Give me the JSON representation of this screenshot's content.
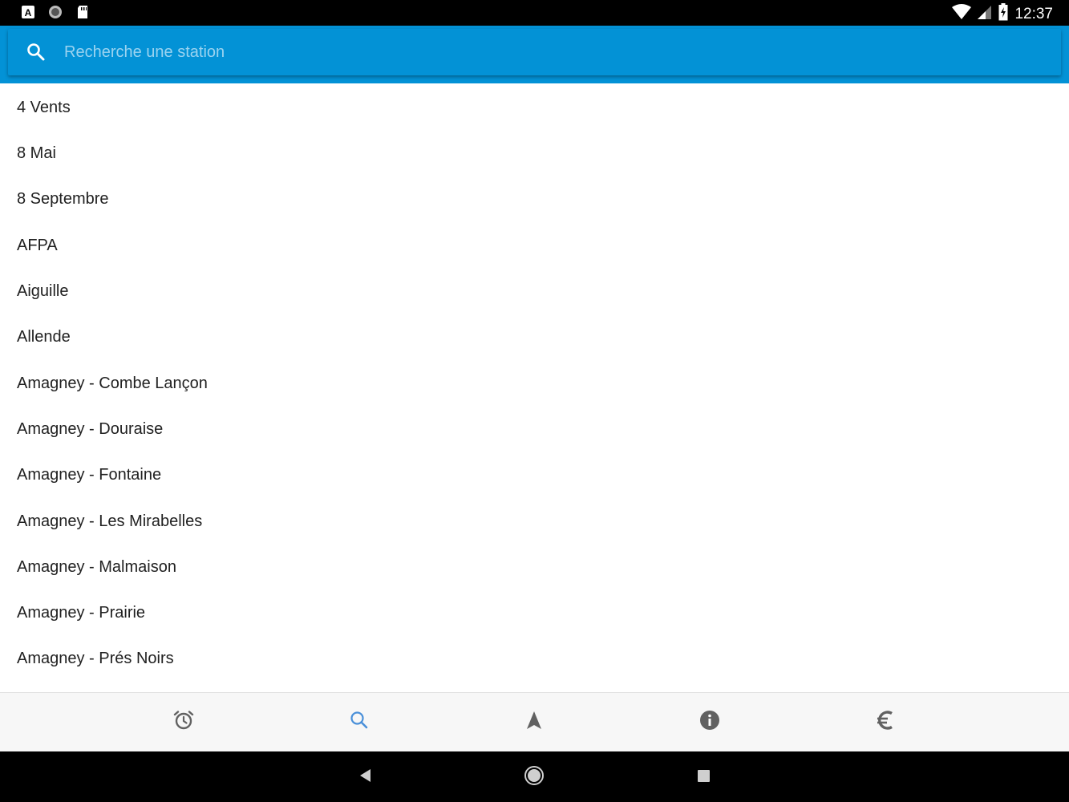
{
  "status_bar": {
    "time": "12:37",
    "left_icons": [
      "a-box-icon",
      "circle-icon",
      "sd-card-icon"
    ],
    "right_icons": [
      "wifi-icon",
      "signal-icon",
      "battery-charging-icon"
    ]
  },
  "search": {
    "placeholder": "Recherche une station",
    "value": ""
  },
  "stations": [
    "4 Vents",
    "8 Mai",
    "8 Septembre",
    "AFPA",
    "Aiguille",
    "Allende",
    "Amagney - Combe Lançon",
    "Amagney - Douraise",
    "Amagney - Fontaine",
    "Amagney - Les Mirabelles",
    "Amagney - Malmaison",
    "Amagney - Prairie",
    "Amagney - Prés Noirs"
  ],
  "bottom_nav": {
    "items": [
      {
        "icon": "alarm-clock-icon",
        "active": false
      },
      {
        "icon": "search-icon",
        "active": true
      },
      {
        "icon": "navigation-arrow-icon",
        "active": false
      },
      {
        "icon": "info-icon",
        "active": false
      },
      {
        "icon": "euro-icon",
        "active": false
      }
    ]
  },
  "colors": {
    "accent": "#0392d6",
    "nav_active": "#4a90d9",
    "nav_inactive": "#616161",
    "text": "#212121"
  }
}
